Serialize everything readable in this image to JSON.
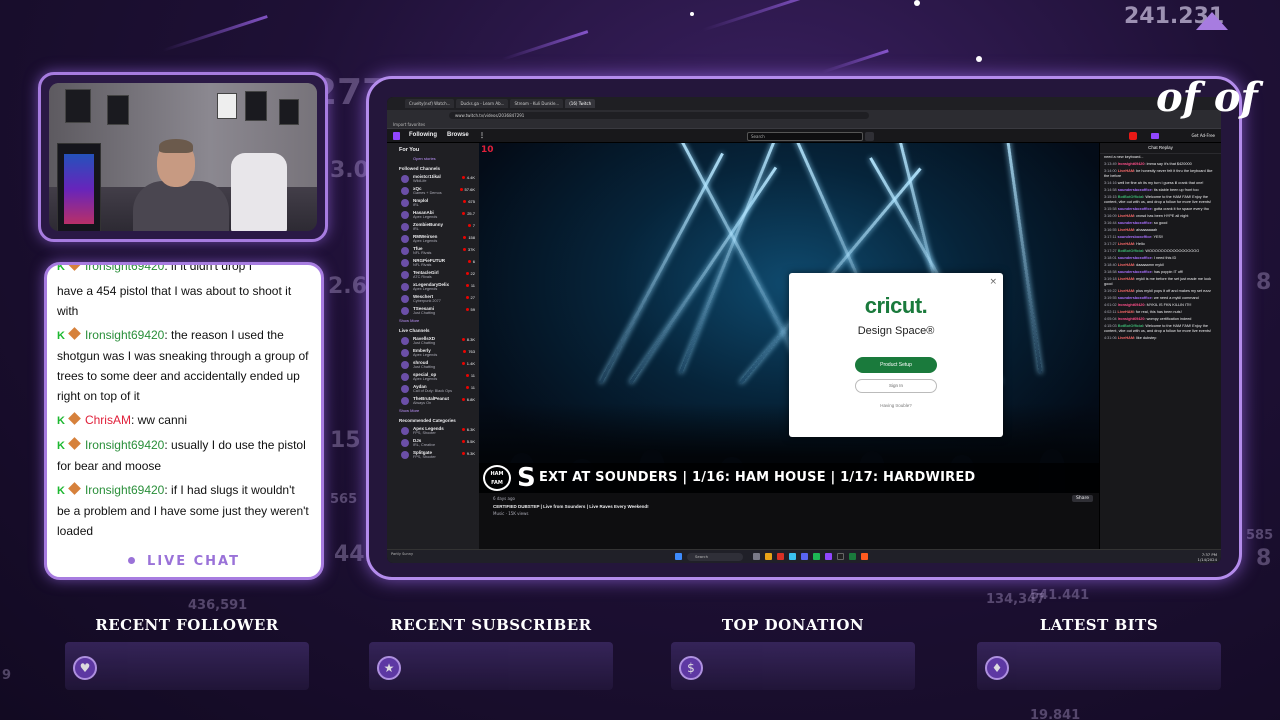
{
  "background": {
    "numbers": [
      "241.231",
      "277",
      "3.00",
      "2.6",
      "15",
      "565",
      "442",
      "8",
      "8",
      "585",
      "541.441",
      "19.841",
      "436,591",
      "134,347",
      "9"
    ]
  },
  "chat_panel": {
    "messages": [
      {
        "user": "Ironsight69420",
        "text": ": if it didn't drop I",
        "class": "iron"
      },
      {
        "user": "",
        "text": "have a 454 pistol that I was about to shoot it with",
        "class": "iron"
      },
      {
        "user": "Ironsight69420",
        "text": ": the reason I used the shotgun was I was sneaking through a group of trees to some deer and accidentally ended up right on top of it",
        "class": "iron"
      },
      {
        "user": "ChrisAM",
        "text": ": ww canni",
        "class": "chris"
      },
      {
        "user": "Ironsight69420",
        "text": ": usually I do use the pistol for bear and moose",
        "class": "iron"
      },
      {
        "user": "Ironsight69420",
        "text": ": if I had slugs it wouldn't be a problem and I have some just they weren't loaded",
        "class": "iron"
      }
    ],
    "footer": "LIVE CHAT"
  },
  "browser": {
    "tabs": [
      "Cruelty(nxf) Watch...",
      "Ducks.ga - Learn Ab...",
      "Stream - Kuli Dunkle...",
      "(16) Twitch"
    ],
    "url": "www.twitch.tv/videos/2036847291",
    "bookmarks": "Import favorites"
  },
  "twitch": {
    "nav": {
      "following": "Following",
      "browse": "Browse",
      "search_placeholder": "Search",
      "right_text": "Get Ad-Free"
    },
    "sidebar": {
      "for_you": "For You",
      "open_stories": "Open stories",
      "followed_heading": "Followed Channels",
      "followed": [
        {
          "name": "moistcr1tikal",
          "game": "WildLife",
          "viewers": "4.4K"
        },
        {
          "name": "xQc",
          "game": "Games + Demos",
          "viewers": "57.6K"
        },
        {
          "name": "Nmplol",
          "game": "IRL",
          "viewers": "675"
        },
        {
          "name": "HasanAbi",
          "game": "Apex Legends",
          "viewers": "25.7"
        },
        {
          "name": "ZombieBunny",
          "game": "IRL",
          "viewers": "7"
        },
        {
          "name": "RMWeirsen",
          "game": "Apex Legends",
          "viewers": "158"
        },
        {
          "name": "Tfue",
          "game": "NFL Rivals",
          "viewers": "37K"
        },
        {
          "name": "NRGPieFUTUR",
          "game": "NFL Rivals",
          "viewers": "6"
        },
        {
          "name": "TentacleGirl",
          "game": "ATC Rivals",
          "viewers": "22"
        },
        {
          "name": "xLegendaryDelix",
          "game": "Apex Legends",
          "viewers": "11"
        },
        {
          "name": "Weschert",
          "game": "Cyberpunk 2077",
          "viewers": "27"
        },
        {
          "name": "TSeesami",
          "game": "Just Chatting",
          "viewers": "59"
        }
      ],
      "show_more": "Show More",
      "live_heading": "Live Channels",
      "live": [
        {
          "name": "RavellsXD",
          "game": "Just Chatting",
          "viewers": "8.3K"
        },
        {
          "name": "Emberly",
          "game": "Apex Legends",
          "viewers": "763"
        },
        {
          "name": "shroud",
          "game": "Just Chatting",
          "viewers": "1.4K"
        },
        {
          "name": "special_op",
          "game": "Apex Legends",
          "viewers": "11"
        },
        {
          "name": "Aydan",
          "game": "Call of Duty: Black Ops",
          "viewers": "11"
        },
        {
          "name": "TheBrutalPeanut",
          "game": "Always On",
          "viewers": "6.8K"
        }
      ],
      "show_more_2": "Show More",
      "recommended_heading": "Recommended Categories",
      "recommended": [
        {
          "name": "Apex Legends",
          "game": "FPS, Shooter",
          "viewers": "6.3K"
        },
        {
          "name": "DJs",
          "game": "IRL, Creative",
          "viewers": "5.5K"
        },
        {
          "name": "Splitgate",
          "game": "FPS, Shooter",
          "viewers": "9.3K"
        }
      ]
    },
    "video": {
      "badge": "10",
      "ticker_big": "S",
      "ticker_text": "EXT AT SOUNDERS | 1/16: HAM HOUSE | 1/17: HARDWIRED",
      "ham_logo": "HAM FAM"
    },
    "info": {
      "ago": "6 days ago",
      "title": "CERTIFIED DUBSTEP | Live from Sounders | Live Raves Every Weekend!",
      "meta": "Music · 15K views",
      "share": "Share"
    },
    "chat": {
      "header": "Chat Replay",
      "messages": [
        {
          "time": "",
          "user": "",
          "cls": "",
          "text": "need a new keyboard..."
        },
        {
          "time": "3:13:49",
          "user": "Ironsight69420",
          "cls": "u1",
          "text": "imma say it's that $420000"
        },
        {
          "time": "3:14:00",
          "user": "LiveHAM",
          "cls": "u2",
          "text": "be honestly never felt it thru the keyboard like the before"
        },
        {
          "time": "3:14:16",
          "user": "",
          "cls": "",
          "text": "well be fine ah its my turn i guess ill crank that one!"
        },
        {
          "time": "3:14:58",
          "user": "soundersboxoffice",
          "cls": "u3",
          "text": "its stable been up front too"
        },
        {
          "time": "3:15:15",
          "user": "BotBotOfficial",
          "cls": "u4",
          "text": "Welcome to the HAM FAM! Enjoy the content, vibe out with us, and drop a follow for more live events!"
        },
        {
          "time": "3:15:58",
          "user": "soundersboxoffice",
          "cls": "u3",
          "text": "gotta crank it for space every tho"
        },
        {
          "time": "3:16:09",
          "user": "LiveHAM",
          "cls": "u2",
          "text": "crowd has been HYPE all night"
        },
        {
          "time": "3:16:44",
          "user": "soundersboxoffice",
          "cls": "u3",
          "text": "so good"
        },
        {
          "time": "3:16:55",
          "user": "LiveHAM",
          "cls": "u2",
          "text": "ahaaaaaaah"
        },
        {
          "time": "3:17:11",
          "user": "soundersboxoffice",
          "cls": "u3",
          "text": "YES!!"
        },
        {
          "time": "3:17:27",
          "user": "LiveHAM",
          "cls": "u2",
          "text": "Hello"
        },
        {
          "time": "3:17:27",
          "user": "BotBotOfficial",
          "cls": "u4",
          "text": "WOOOOOOOOOOOOOOOOO"
        },
        {
          "time": "3:18:01",
          "user": "soundersboxoffice",
          "cls": "u3",
          "text": "I need this ID"
        },
        {
          "time": "3:18:40",
          "user": "LiveHAM",
          "cls": "u2",
          "text": "daaaaamn mykil"
        },
        {
          "time": "3:18:58",
          "user": "soundersboxoffice",
          "cls": "u3",
          "text": "has poppin IT off!"
        },
        {
          "time": "3:19:18",
          "user": "LiveHAM",
          "cls": "u2",
          "text": "mykil is me before the set just made me look good"
        },
        {
          "time": "3:19:22",
          "user": "LiveHAM",
          "cls": "u2",
          "text": "plus mykil pops it off and makes my set ezzz"
        },
        {
          "time": "3:19:55",
          "user": "soundersboxoffice",
          "cls": "u3",
          "text": "we need a mykil command"
        },
        {
          "time": "4:01:02",
          "user": "Ironsight69420",
          "cls": "u1",
          "text": "MYKIL IS FKN KILLIN IT!!!"
        },
        {
          "time": "4:02:11",
          "user": "LiveHAM",
          "cls": "u2",
          "text": "for real, this has been nuts!"
        },
        {
          "time": "4:05:04",
          "user": "Ironsight69420",
          "cls": "u1",
          "text": "wompy certification indeed"
        },
        {
          "time": "4:15:03",
          "user": "BotBotOfficial",
          "cls": "u4",
          "text": "Welcome to the HAM FAM! Enjoy the content, vibe out with us, and drop a follow for more live events!"
        },
        {
          "time": "4:31:06",
          "user": "LiveHAM",
          "cls": "u2",
          "text": "like dubstep"
        }
      ]
    },
    "taskbar": {
      "left": "Partly Sunny",
      "search": "Search",
      "time": "7:37 PM",
      "date": "1/14/2024"
    }
  },
  "modal": {
    "brand": "cricut.",
    "subtitle": "Design Space®",
    "primary": "Product Setup",
    "secondary": "Sign In",
    "help": "Having trouble?",
    "close": "×"
  },
  "signature": "of of",
  "stats": [
    {
      "label": "RECENT FOLLOWER",
      "icon": "heart-icon",
      "glyph": "♥"
    },
    {
      "label": "RECENT SUBSCRIBER",
      "icon": "star-icon",
      "glyph": "★"
    },
    {
      "label": "TOP DONATION",
      "icon": "dollar-icon",
      "glyph": "$"
    },
    {
      "label": "LATEST BITS",
      "icon": "diamond-icon",
      "glyph": "♦"
    }
  ],
  "colors": {
    "accent": "#a77ce0",
    "twitch_purple": "#9146ff",
    "cricut_green": "#1a7a3c"
  }
}
